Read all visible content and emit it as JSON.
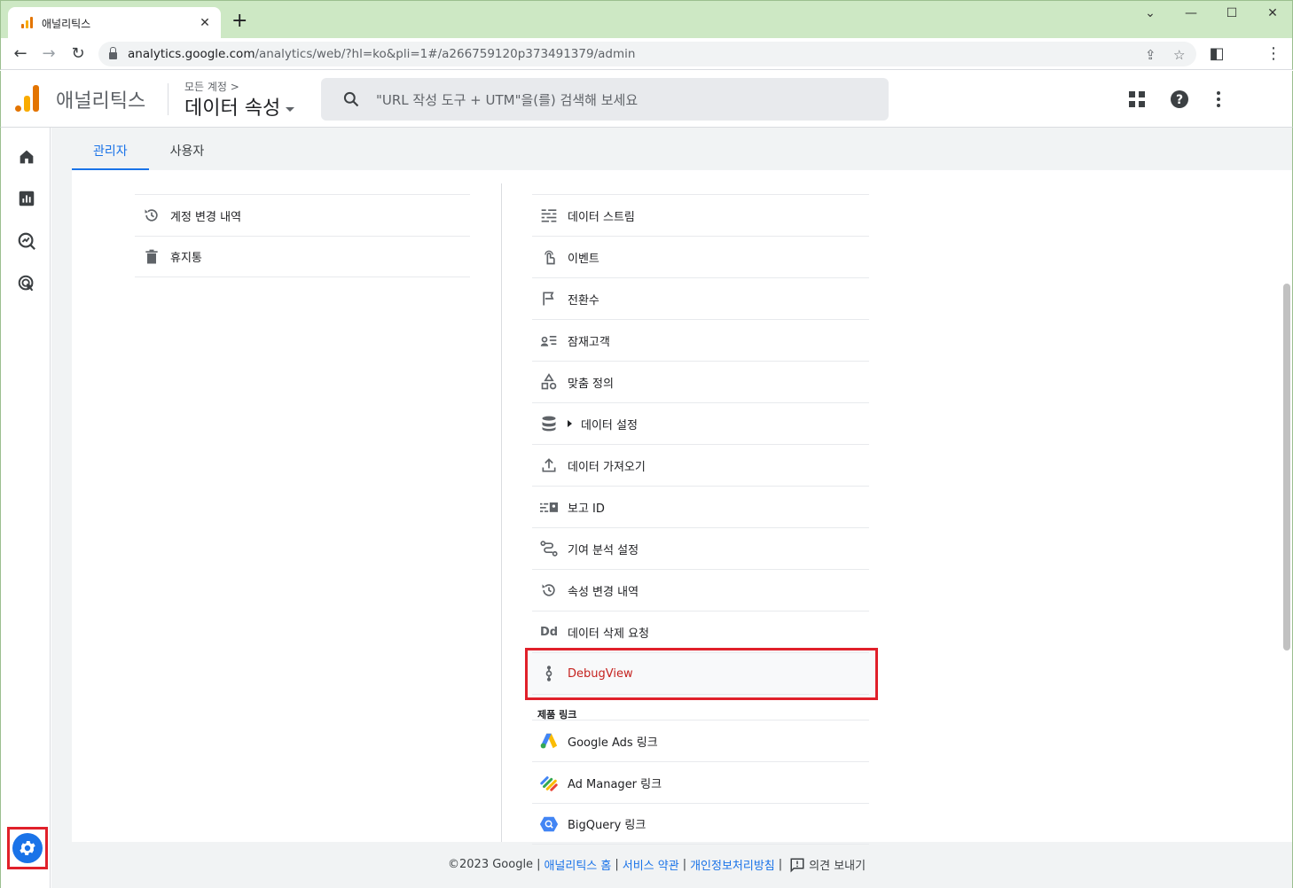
{
  "browser": {
    "tab_title": "애널리틱스",
    "new_tab": "+",
    "url_host": "analytics.google.com",
    "url_path": "/analytics/web/?hl=ko&pli=1#/a266759120p373491379/admin"
  },
  "header": {
    "product": "애널리틱스",
    "account_crumb": "모든 계정 >",
    "property_name": "데이터 속성",
    "search_placeholder": "\"URL 작성 도구 + UTM\"을(를) 검색해 보세요"
  },
  "tabs": [
    {
      "label": "관리자",
      "active": true
    },
    {
      "label": "사용자",
      "active": false
    }
  ],
  "account_menu": [
    {
      "label": "계정 변경 내역",
      "icon": "history-icon"
    },
    {
      "label": "휴지통",
      "icon": "trash-icon"
    }
  ],
  "property_menu": [
    {
      "label": "데이터 스트림",
      "icon": "data-streams-icon"
    },
    {
      "label": "이벤트",
      "icon": "touch-icon"
    },
    {
      "label": "전환수",
      "icon": "flag-icon"
    },
    {
      "label": "잠재고객",
      "icon": "audience-icon"
    },
    {
      "label": "맞춤 정의",
      "icon": "shapes-icon"
    },
    {
      "label": "데이터 설정",
      "icon": "database-icon",
      "expandable": true
    },
    {
      "label": "데이터 가져오기",
      "icon": "upload-icon"
    },
    {
      "label": "보고 ID",
      "icon": "report-id-icon"
    },
    {
      "label": "기여 분석 설정",
      "icon": "attribution-icon"
    },
    {
      "label": "속성 변경 내역",
      "icon": "history-icon"
    },
    {
      "label": "데이터 삭제 요청",
      "icon": "data-deletion-icon"
    },
    {
      "label": "DebugView",
      "icon": "debug-icon",
      "highlighted": true
    }
  ],
  "product_links": {
    "section_label": "제품 링크",
    "items": [
      {
        "label": "Google Ads 링크",
        "icon": "google-ads-icon"
      },
      {
        "label": "Ad Manager 링크",
        "icon": "ad-manager-icon"
      },
      {
        "label": "BigQuery 링크",
        "icon": "bigquery-icon"
      }
    ]
  },
  "footer": {
    "copyright": "©2023 Google",
    "sep": "|",
    "home": "애널리틱스 홈",
    "terms": "서비스 약관",
    "privacy": "개인정보처리방침",
    "feedback": "의견 보내기"
  },
  "colors": {
    "accent": "#1a73e8",
    "highlight_border": "#e0202a",
    "debug_text": "#c5221f",
    "chrome_frame": "#cde8c4"
  }
}
